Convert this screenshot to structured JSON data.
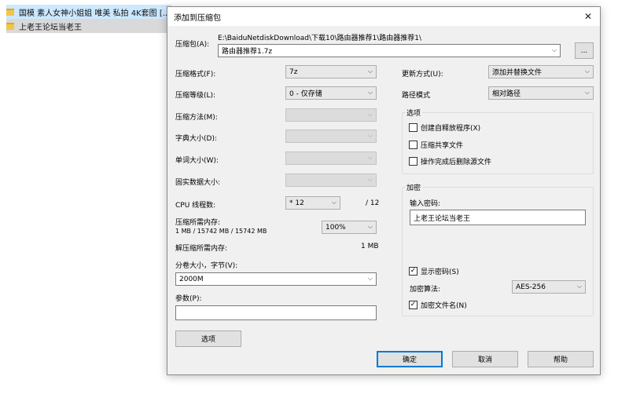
{
  "background": {
    "rows": [
      {
        "label": "国模 素人女神小姐姐 唯美 私拍 4K套图 [..."
      },
      {
        "label": "上老王论坛当老王"
      }
    ]
  },
  "dialog": {
    "title": "添加到压缩包",
    "close_glyph": "✕",
    "archive": {
      "label": "压缩包(A):",
      "path": "E:\\BaiduNetdiskDownload\\下载10\\路由器推荐1\\路由器推荐1\\",
      "name": "路由器推荐1.7z",
      "browse_label": "..."
    },
    "left": {
      "format_label": "压缩格式(F):",
      "format_value": "7z",
      "level_label": "压缩等级(L):",
      "level_value": "0 - 仅存储",
      "method_label": "压缩方法(M):",
      "dict_label": "字典大小(D):",
      "word_label": "单词大小(W):",
      "solid_label": "固实数据大小:",
      "cpu_label": "CPU 线程数:",
      "cpu_value": "* 12",
      "cpu_max": "/ 12",
      "mem_comp_label": "压缩所需内存:",
      "mem_comp_detail": "1 MB / 15742 MB / 15742 MB",
      "mem_percent": "100%",
      "mem_decomp_label": "解压缩所需内存:",
      "mem_decomp_value": "1 MB",
      "split_label": "分卷大小，字节(V):",
      "split_value": "2000M",
      "params_label": "参数(P):",
      "params_value": "",
      "options_button": "选项"
    },
    "right": {
      "update_label": "更新方式(U):",
      "update_value": "添加并替换文件",
      "path_label": "路径模式",
      "path_value": "相对路径",
      "options_group": "选项",
      "opt_sfx": "创建自释放程序(X)",
      "opt_shared": "压缩共享文件",
      "opt_delete": "操作完成后删除源文件",
      "enc_group": "加密",
      "password_label": "输入密码:",
      "password_value": "上老王论坛当老王",
      "show_password": "显示密码(S)",
      "enc_method_label": "加密算法:",
      "enc_method_value": "AES-256",
      "enc_filenames": "加密文件名(N)"
    },
    "buttons": {
      "ok": "确定",
      "cancel": "取消",
      "help": "帮助"
    },
    "checkbox_mark": "✓",
    "dropdown_glyph": "⌵"
  }
}
